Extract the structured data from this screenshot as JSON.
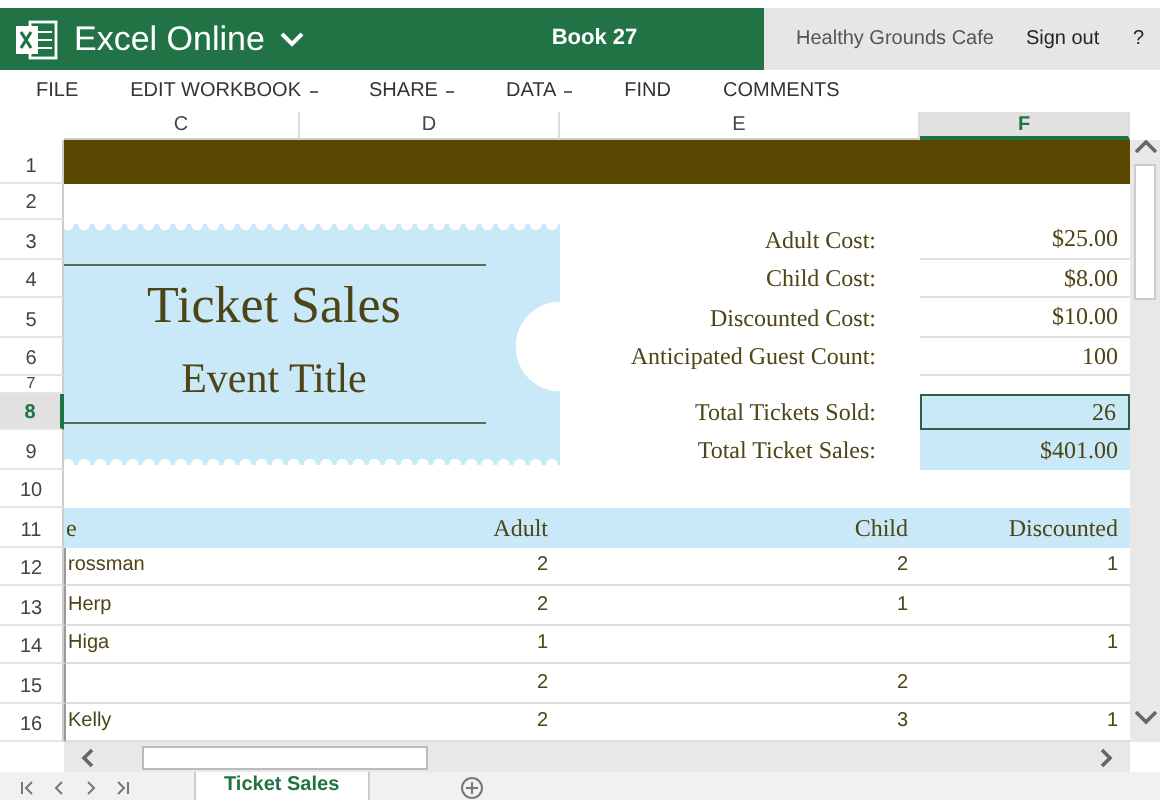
{
  "app": {
    "title": "Excel Online",
    "book": "Book 27",
    "account": "Healthy Grounds Cafe",
    "sign_out": "Sign out",
    "help": "?"
  },
  "ribbon": [
    {
      "label": "FILE",
      "dropdown": false
    },
    {
      "label": "EDIT WORKBOOK",
      "dropdown": true
    },
    {
      "label": "SHARE",
      "dropdown": true
    },
    {
      "label": "DATA",
      "dropdown": true
    },
    {
      "label": "FIND",
      "dropdown": false
    },
    {
      "label": "COMMENTS",
      "dropdown": false
    }
  ],
  "columns": [
    {
      "label": "C",
      "selected": false
    },
    {
      "label": "D",
      "selected": false
    },
    {
      "label": "E",
      "selected": false
    },
    {
      "label": "F",
      "selected": true
    }
  ],
  "row_headers": [
    {
      "label": "1",
      "selected": false
    },
    {
      "label": "2",
      "selected": false
    },
    {
      "label": "3",
      "selected": false
    },
    {
      "label": "4",
      "selected": false
    },
    {
      "label": "5",
      "selected": false
    },
    {
      "label": "6",
      "selected": false
    },
    {
      "label": "7",
      "selected": false
    },
    {
      "label": "8",
      "selected": true
    },
    {
      "label": "9",
      "selected": false
    },
    {
      "label": "10",
      "selected": false
    },
    {
      "label": "11",
      "selected": false
    },
    {
      "label": "12",
      "selected": false
    },
    {
      "label": "13",
      "selected": false
    },
    {
      "label": "14",
      "selected": false
    },
    {
      "label": "15",
      "selected": false
    },
    {
      "label": "16",
      "selected": false
    }
  ],
  "ticket": {
    "title": "Ticket Sales",
    "subtitle": "Event Title"
  },
  "summary": [
    {
      "label": "Adult Cost:",
      "value": "$25.00",
      "kind": "input",
      "selected": false
    },
    {
      "label": "Child Cost:",
      "value": "$8.00",
      "kind": "input",
      "selected": false
    },
    {
      "label": "Discounted Cost:",
      "value": "$10.00",
      "kind": "input",
      "selected": false
    },
    {
      "label": "Anticipated Guest Count:",
      "value": "100",
      "kind": "input",
      "selected": false
    },
    {
      "label": "Total Tickets Sold:",
      "value": "26",
      "kind": "total",
      "selected": true
    },
    {
      "label": "Total Ticket Sales:",
      "value": "$401.00",
      "kind": "total",
      "selected": false
    }
  ],
  "table": {
    "columns": [
      "e",
      "Adult",
      "Child",
      "Discounted"
    ],
    "rows": [
      [
        "rossman",
        "2",
        "2",
        "1"
      ],
      [
        "Herp",
        "2",
        "1",
        null
      ],
      [
        "Higa",
        "1",
        null,
        "1"
      ],
      [
        null,
        "2",
        "2",
        null
      ],
      [
        "Kelly",
        "2",
        "3",
        "1"
      ]
    ]
  },
  "sheet_tabs": [
    {
      "label": "Ticket Sales",
      "selected": true
    }
  ]
}
